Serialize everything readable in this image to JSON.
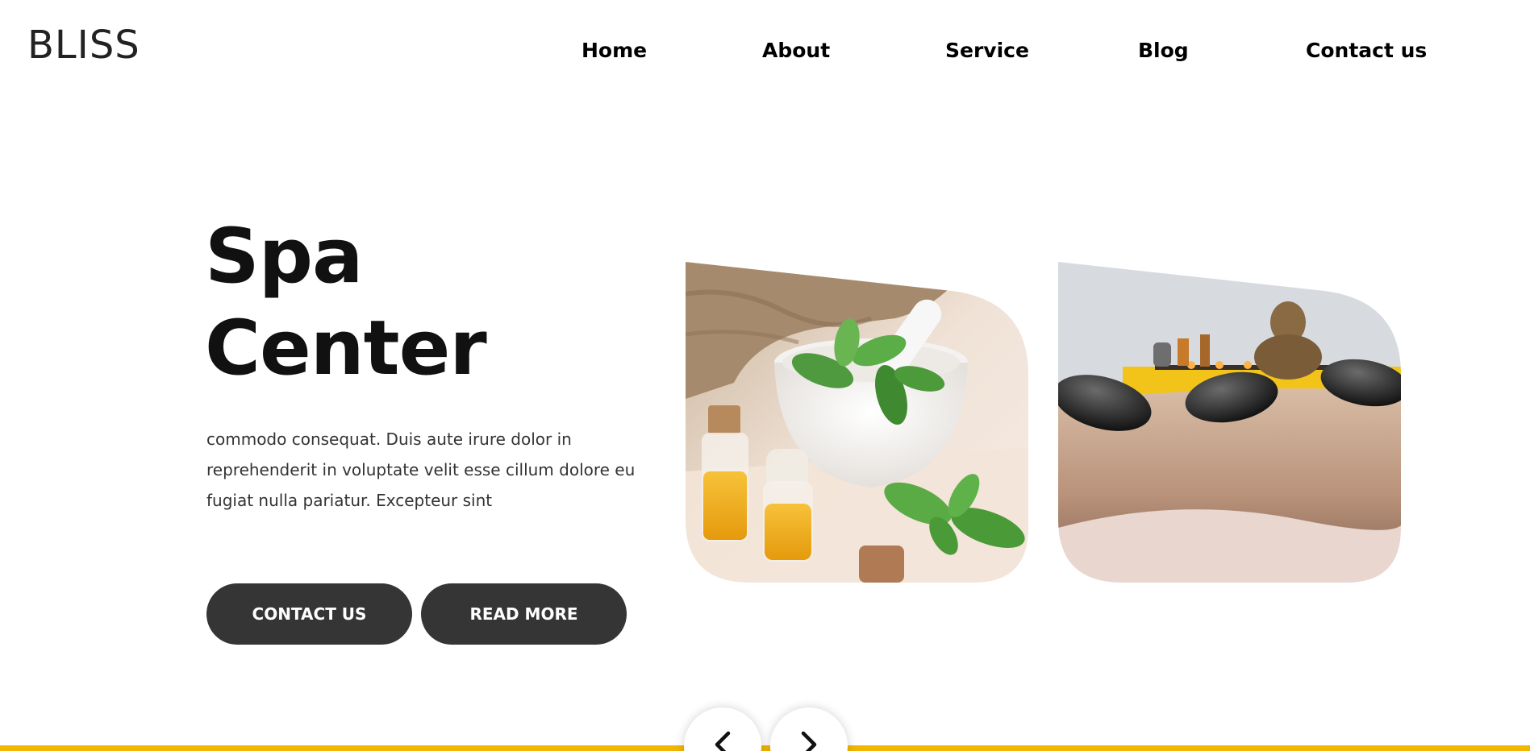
{
  "header": {
    "logo": "BLISS",
    "nav": [
      {
        "label": "Home"
      },
      {
        "label": "About"
      },
      {
        "label": "Service"
      },
      {
        "label": "Blog"
      },
      {
        "label": "Contact us"
      }
    ]
  },
  "hero": {
    "title_line1": "Spa",
    "title_line2": "Center",
    "description": "commodo consequat. Duis aute irure dolor in reprehenderit in voluptate velit esse cillum dolore eu fugiat nulla pariatur. Excepteur sint",
    "buttons": {
      "contact": "CONTACT US",
      "read_more": "READ MORE"
    }
  },
  "slider": {
    "prev_icon": "chevron-left-icon",
    "next_icon": "chevron-right-icon"
  },
  "colors": {
    "accent": "#f2b600",
    "button_bg": "#353535",
    "text": "#111111"
  }
}
